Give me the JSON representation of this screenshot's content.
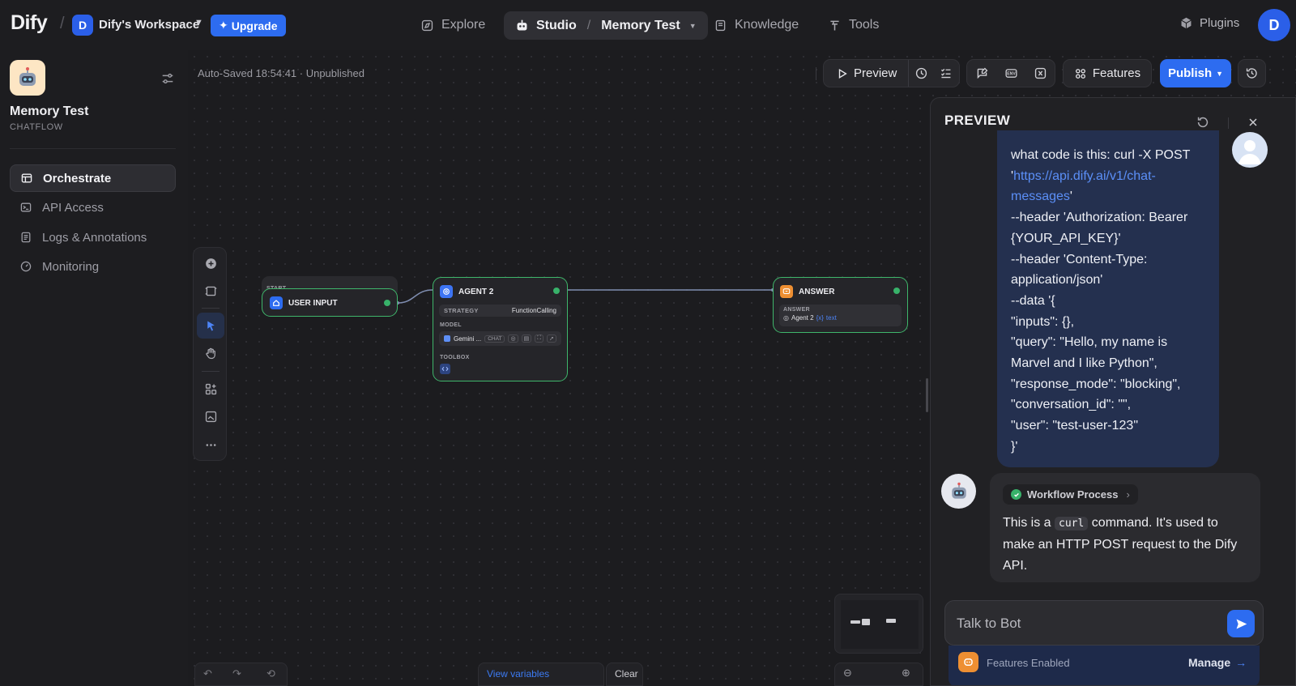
{
  "brand": {
    "logo": "Dify",
    "separator": "/"
  },
  "workspace": {
    "initial": "D",
    "name": "Dify's Workspace",
    "upgrade_label": "Upgrade"
  },
  "nav": {
    "explore": "Explore",
    "studio": "Studio",
    "studio_sep": "/",
    "current_app": "Memory Test",
    "knowledge": "Knowledge",
    "tools": "Tools",
    "plugins": "Plugins",
    "user_initial": "D"
  },
  "sidebar": {
    "app_name": "Memory Test",
    "app_type": "CHATFLOW",
    "items": [
      {
        "label": "Orchestrate",
        "icon": "layout-icon",
        "active": true
      },
      {
        "label": "API Access",
        "icon": "terminal-icon",
        "active": false
      },
      {
        "label": "Logs & Annotations",
        "icon": "document-icon",
        "active": false
      },
      {
        "label": "Monitoring",
        "icon": "gauge-icon",
        "active": false
      }
    ]
  },
  "toolbar": {
    "autosave": "Auto-Saved 18:54:41 · Unpublished",
    "preview_label": "Preview",
    "features_label": "Features",
    "publish_label": "Publish",
    "env_label": "ENV"
  },
  "workflow": {
    "start_group": "START",
    "start_node": "USER INPUT",
    "agent_node": {
      "title": "AGENT 2",
      "strategy_label": "STRATEGY",
      "strategy_value": "FunctionCalling",
      "model_label": "MODEL",
      "model_name": "Gemini ...",
      "model_mode": "CHAT",
      "toolbox_label": "TOOLBOX"
    },
    "answer_node": {
      "title": "ANSWER",
      "field_label": "ANSWER",
      "var_source": "Agent 2",
      "var_name": "text"
    }
  },
  "preview": {
    "title": "PREVIEW",
    "user_message_lines": [
      {
        "text": "what code is this: curl -X POST"
      },
      {
        "text": "'",
        "link": "https://api.dify.ai/v1/chat-"
      },
      {
        "link": "messages",
        "text": "'"
      },
      {
        "text": "--header 'Authorization: Bearer"
      },
      {
        "text": "{YOUR_API_KEY}'"
      },
      {
        "text": "--header 'Content-Type:"
      },
      {
        "text": "application/json'"
      },
      {
        "text": "--data '{"
      },
      {
        "text": "\"inputs\": {},"
      },
      {
        "text": "\"query\": \"Hello, my name is"
      },
      {
        "text": "Marvel and I like Python\","
      },
      {
        "text": "\"response_mode\": \"blocking\","
      },
      {
        "text": "\"conversation_id\": \"\","
      },
      {
        "text": "\"user\": \"test-user-123\""
      },
      {
        "text": "}'"
      }
    ],
    "workflow_process": "Workflow Process",
    "bot_reply_prefix": "This is a",
    "bot_reply_code": "curl",
    "bot_reply_suffix": "command. It's used to make an HTTP POST request to the Dify API.",
    "input_placeholder": "Talk to Bot",
    "features_enabled": "Features Enabled",
    "manage_label": "Manage"
  },
  "canvas_bottom": {
    "view_variables": "View variables",
    "clear": "Clear"
  },
  "colors": {
    "accent": "#2d6cf0",
    "success": "#38b26a",
    "answer": "#ee8f32"
  }
}
